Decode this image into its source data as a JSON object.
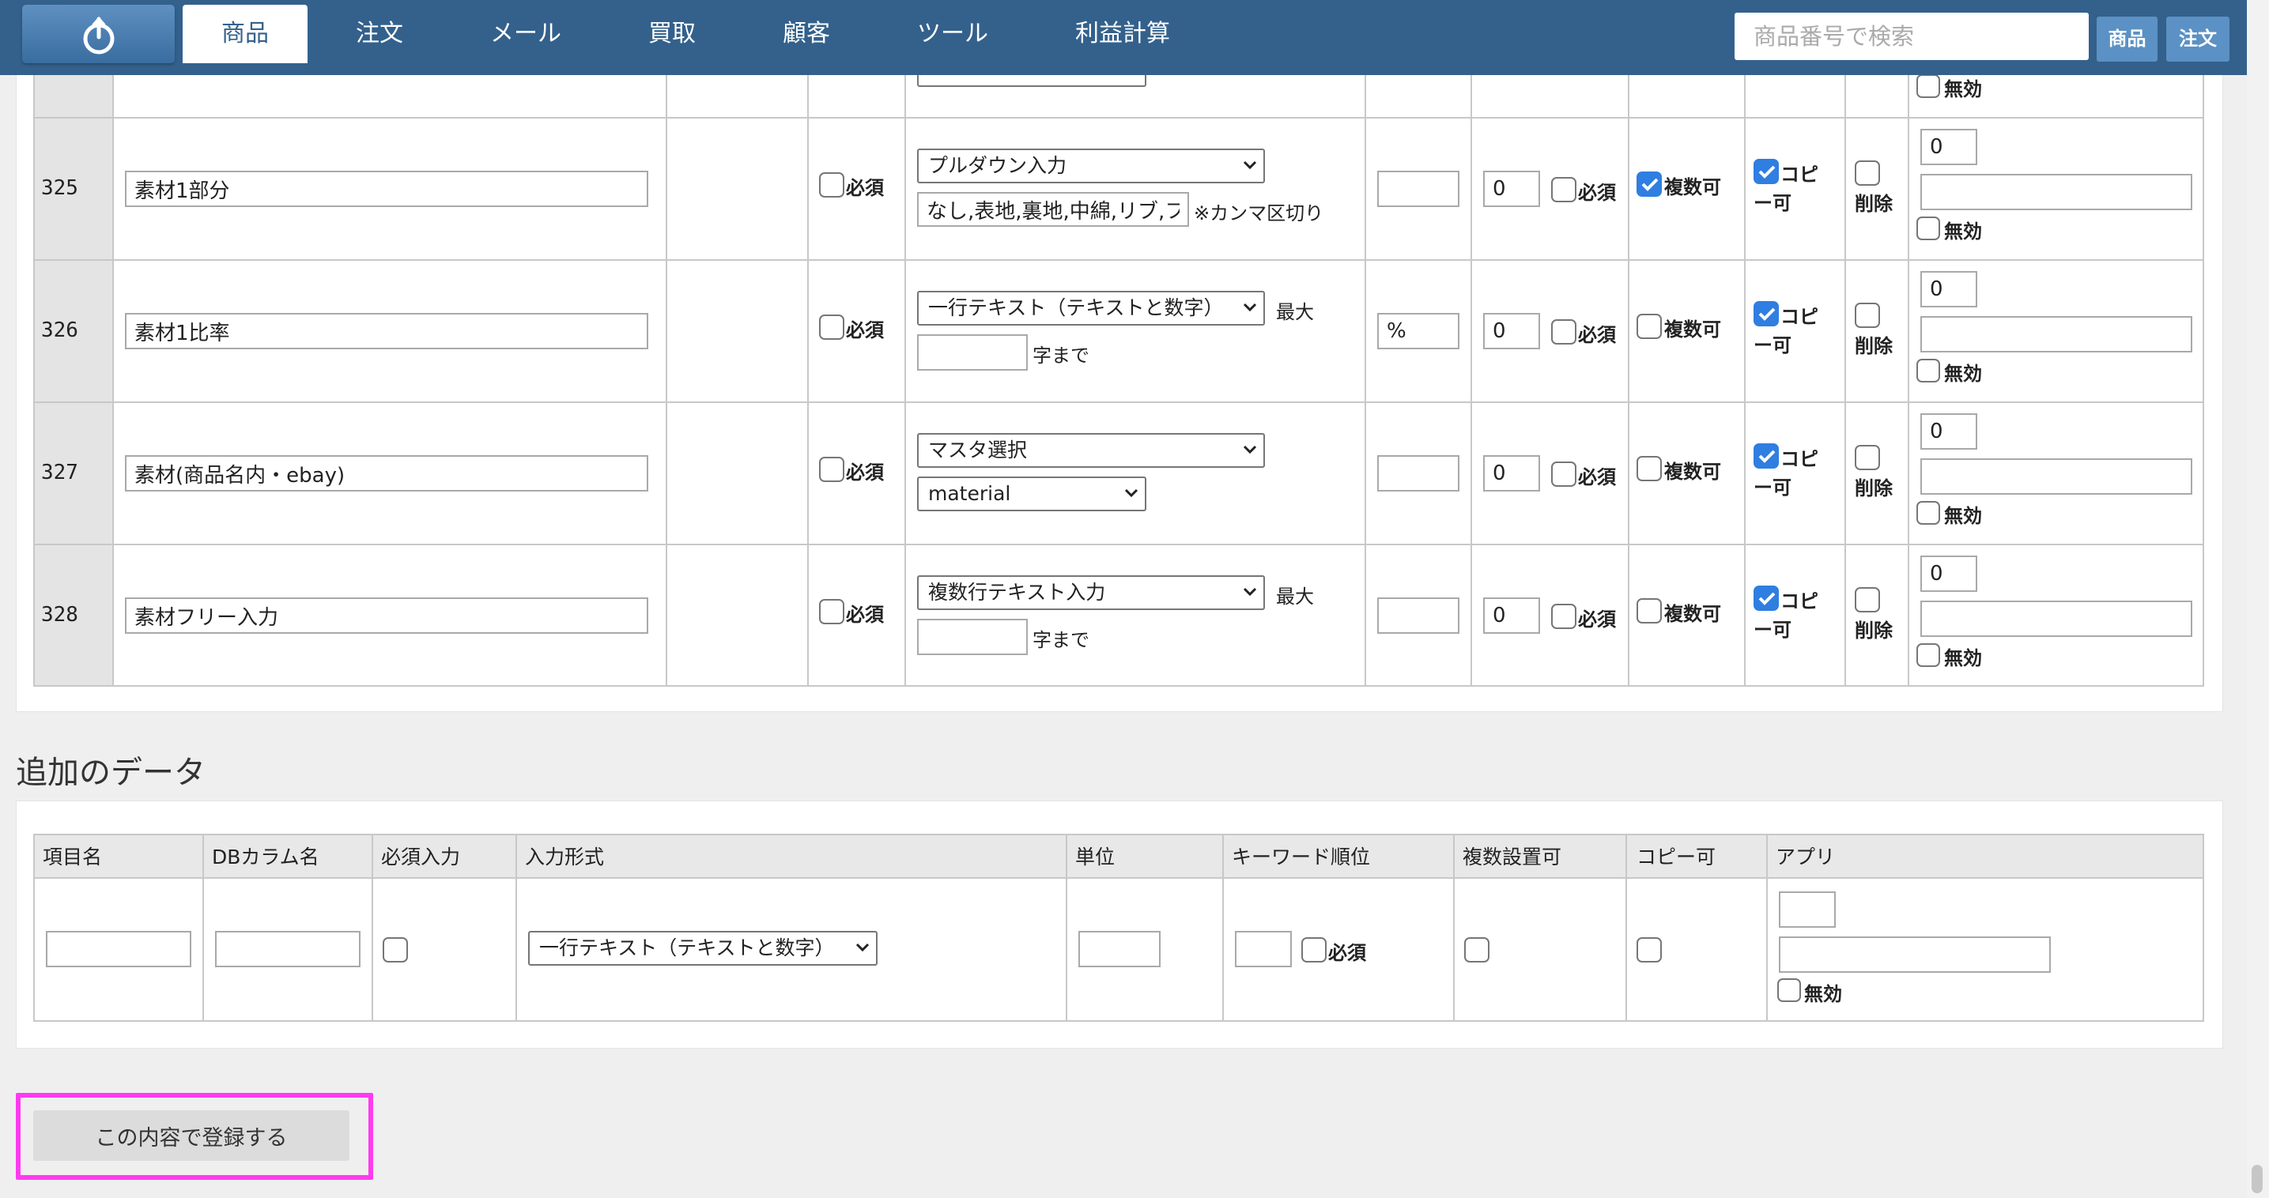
{
  "nav": {
    "tabs": [
      "商品",
      "注文",
      "メール",
      "買取",
      "顧客",
      "ツール",
      "利益計算"
    ],
    "search_placeholder": "商品番号で検索",
    "search_product_btn": "商品",
    "search_order_btn": "注文"
  },
  "labels": {
    "required": "必須",
    "multiple_ok": "複数可",
    "copy_ok_1": "コピ",
    "copy_ok_2": "ー可",
    "delete": "削除",
    "invalid": "無効",
    "max": "最大",
    "chars_upto": "字まで",
    "comma_note": "※カンマ区切り"
  },
  "rows": [
    {
      "num": "325",
      "name": "素材1部分",
      "input_type": "プルダウン入力",
      "options_text": "なし,表地,裏地,中綿,リブ,フ",
      "unit": "",
      "keyword_order": "0",
      "kw_required": false,
      "multiple": true,
      "copy": true,
      "app_value": "0"
    },
    {
      "num": "326",
      "name": "素材1比率",
      "input_type": "一行テキスト（テキストと数字）",
      "unit": "%",
      "keyword_order": "0",
      "kw_required": false,
      "multiple": false,
      "copy": true,
      "app_value": "0"
    },
    {
      "num": "327",
      "name": "素材(商品名内・ebay)",
      "input_type": "マスタ選択",
      "master": "material",
      "unit": "",
      "keyword_order": "0",
      "kw_required": false,
      "multiple": false,
      "copy": true,
      "app_value": "0"
    },
    {
      "num": "328",
      "name": "素材フリー入力",
      "input_type": "複数行テキスト入力",
      "unit": "",
      "keyword_order": "0",
      "kw_required": false,
      "multiple": false,
      "copy": true,
      "app_value": "0"
    }
  ],
  "add_section": {
    "title": "追加のデータ",
    "headers": [
      "項目名",
      "DBカラム名",
      "必須入力",
      "入力形式",
      "単位",
      "キーワード順位",
      "複数設置可",
      "コピー可",
      "アプリ"
    ],
    "input_type": "一行テキスト（テキストと数字）",
    "required_label": "必須",
    "invalid_label": "無効"
  },
  "submit_label": "この内容で登録する"
}
